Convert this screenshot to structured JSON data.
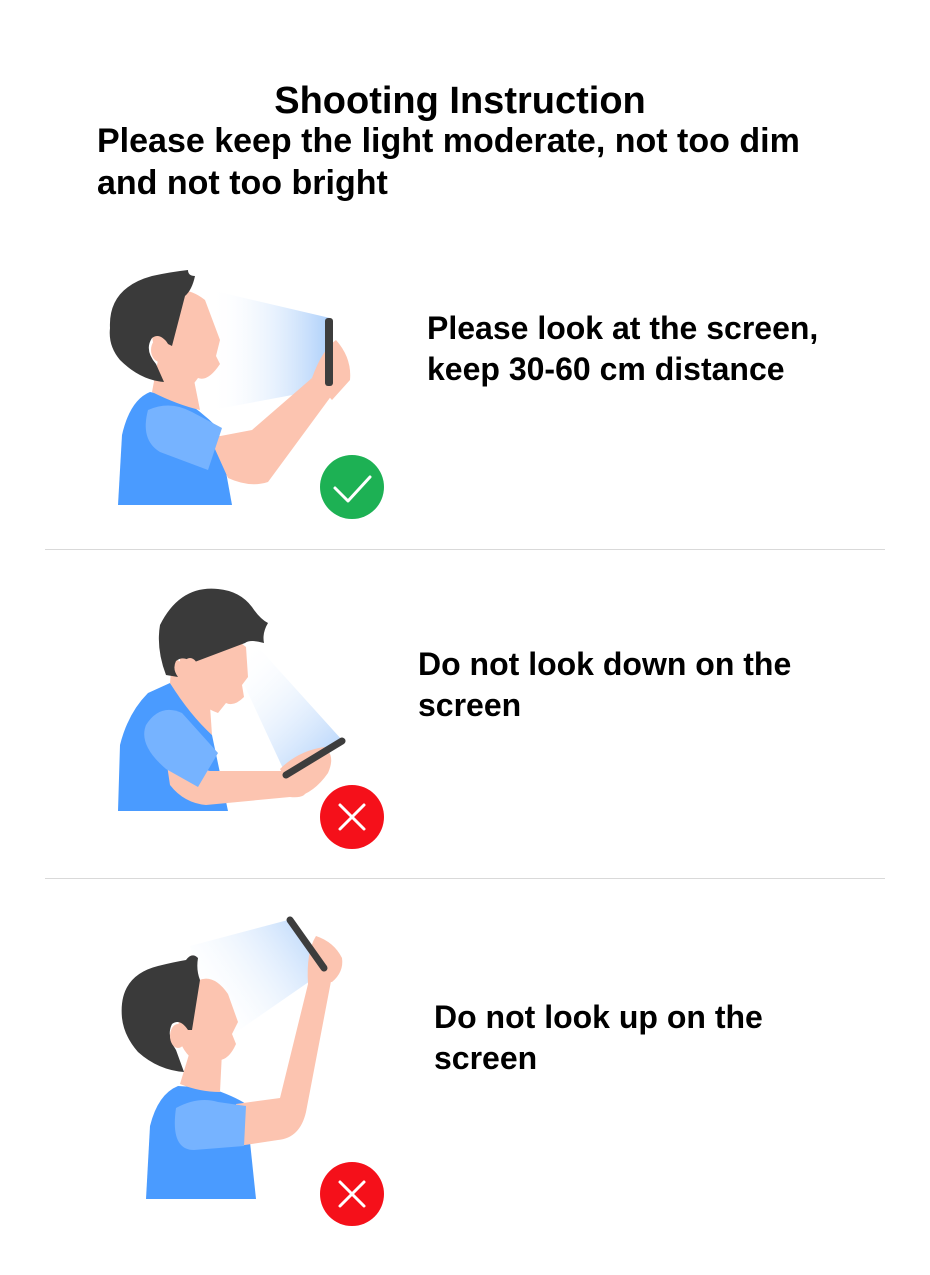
{
  "header": {
    "title": "Shooting Instruction",
    "light_note": "Please keep the light moderate, not too dim and not too bright"
  },
  "tips": [
    {
      "text": "Please look at the screen, keep 30-60 cm distance",
      "status": "correct",
      "status_icon": "check-icon",
      "status_color": "#1db154"
    },
    {
      "text": "Do not look down on the screen",
      "status": "wrong",
      "status_icon": "cross-icon",
      "status_color": "#f5101a"
    },
    {
      "text": "Do not look up on the screen",
      "status": "wrong",
      "status_icon": "cross-icon",
      "status_color": "#f5101a"
    }
  ],
  "colors": {
    "shirt": "#4a9bff",
    "sleeve": "#76b3ff",
    "skin": "#fcc4b0",
    "hair": "#3a3a3a",
    "phone": "#3d3d3d",
    "divider": "#d9d9d9"
  }
}
